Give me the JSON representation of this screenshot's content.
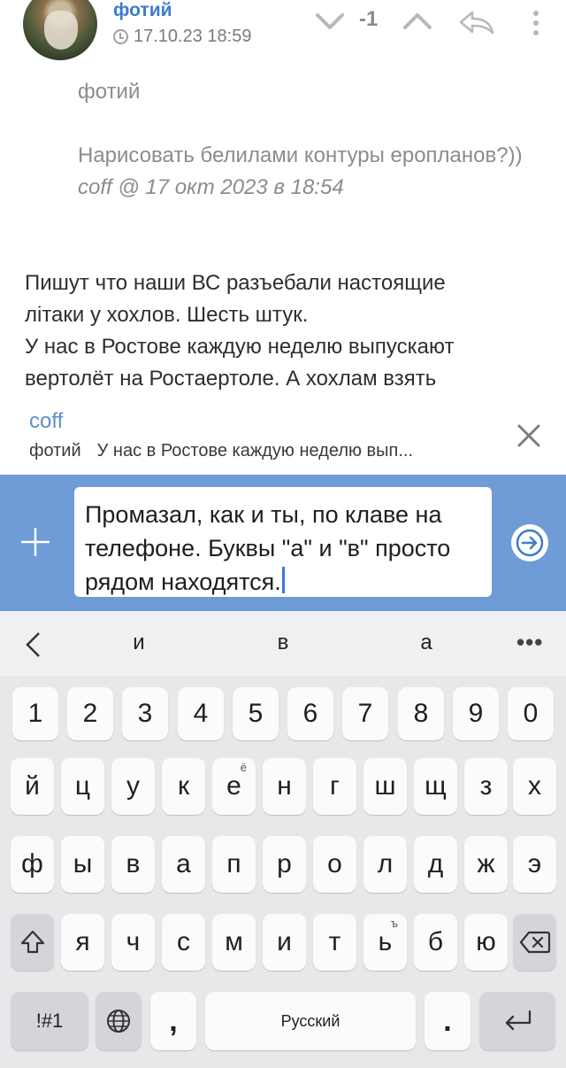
{
  "comment": {
    "author": "фотий",
    "date": "17.10.23 18:59",
    "rating": "-1",
    "quote": {
      "author": "фотий",
      "text": "Нарисовать белилами контуры еропланов?))",
      "signature": "coff @ 17 окт 2023 в 18:54"
    },
    "body": [
      "Пишут что наши ВС разъебали настоящие",
      "літаки у хохлов. Шесть штук.",
      "У нас в Ростове каждую неделю выпускают",
      "вертолёт на Ростаертоле. А хохлам взять"
    ]
  },
  "reply_preview": {
    "author": "coff",
    "to": "фотий",
    "snippet": "У нас в Ростове каждую неделю вып..."
  },
  "compose": {
    "text": "Промазал, как и ты, по клаве на телефоне. Буквы \"а\" и \"в\" просто рядом находятся."
  },
  "keyboard": {
    "suggestions": [
      "и",
      "в",
      "а"
    ],
    "more": "•••",
    "row_digits": [
      "1",
      "2",
      "3",
      "4",
      "5",
      "6",
      "7",
      "8",
      "9",
      "0"
    ],
    "row1": [
      "й",
      "ц",
      "у",
      "к",
      "е",
      "н",
      "г",
      "ш",
      "щ",
      "з",
      "х"
    ],
    "row1_hint_e": "ё",
    "row2": [
      "ф",
      "ы",
      "в",
      "а",
      "п",
      "р",
      "о",
      "л",
      "д",
      "ж",
      "э"
    ],
    "row3": [
      "я",
      "ч",
      "с",
      "м",
      "и",
      "т",
      "ь",
      "б",
      "ю"
    ],
    "row3_hint_soft": "ъ",
    "symbols_label": "!#1",
    "comma": ",",
    "space_label": "Русский",
    "period": "."
  },
  "icons": {
    "vote_down": "chevron-down-icon",
    "vote_up": "chevron-up-icon",
    "reply": "reply-arrow-icon",
    "more": "vertical-dots-icon",
    "close": "close-icon",
    "attach": "plus-icon",
    "send": "send-arrow-icon",
    "shift": "shift-icon",
    "backspace": "backspace-icon",
    "language": "globe-icon",
    "enter": "enter-icon"
  },
  "colors": {
    "link": "#3d7cc9",
    "compose_bar": "#6f9bd6",
    "keyboard_bg": "#e7e8ea"
  }
}
